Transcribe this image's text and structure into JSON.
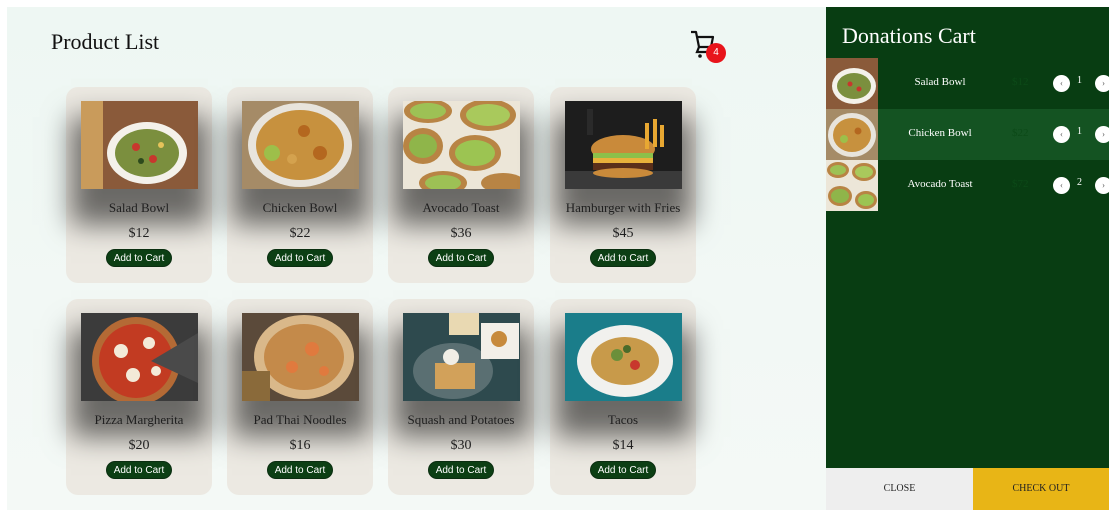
{
  "main": {
    "title": "Product List",
    "cart_badge_count": "4",
    "add_to_cart_label": "Add to Cart"
  },
  "products": [
    {
      "name": "Salad Bowl",
      "price": "$12",
      "image": "salad-bowl-image"
    },
    {
      "name": "Chicken Bowl",
      "price": "$22",
      "image": "chicken-bowl-image"
    },
    {
      "name": "Avocado Toast",
      "price": "$36",
      "image": "avocado-toast-image"
    },
    {
      "name": "Hamburger with Fries",
      "price": "$45",
      "image": "hamburger-image"
    },
    {
      "name": "Pizza Margherita",
      "price": "$20",
      "image": "pizza-image"
    },
    {
      "name": "Pad Thai Noodles",
      "price": "$16",
      "image": "pad-thai-image"
    },
    {
      "name": "Squash and Potatoes",
      "price": "$30",
      "image": "squash-potatoes-image"
    },
    {
      "name": "Tacos",
      "price": "$14",
      "image": "tacos-image"
    }
  ],
  "cart": {
    "title": "Donations Cart",
    "items": [
      {
        "name": "Salad Bowl",
        "price": "$12",
        "qty": "1"
      },
      {
        "name": "Chicken Bowl",
        "price": "$22",
        "qty": "1"
      },
      {
        "name": "Avocado Toast",
        "price": "$72",
        "qty": "2"
      }
    ],
    "close_label": "CLOSE",
    "checkout_label": "CHECK OUT"
  },
  "colors": {
    "accent_green": "#0c3f14",
    "sidebar_bg": "#083d12",
    "badge_red": "#e8141b",
    "checkout_yellow": "#e8b516"
  }
}
